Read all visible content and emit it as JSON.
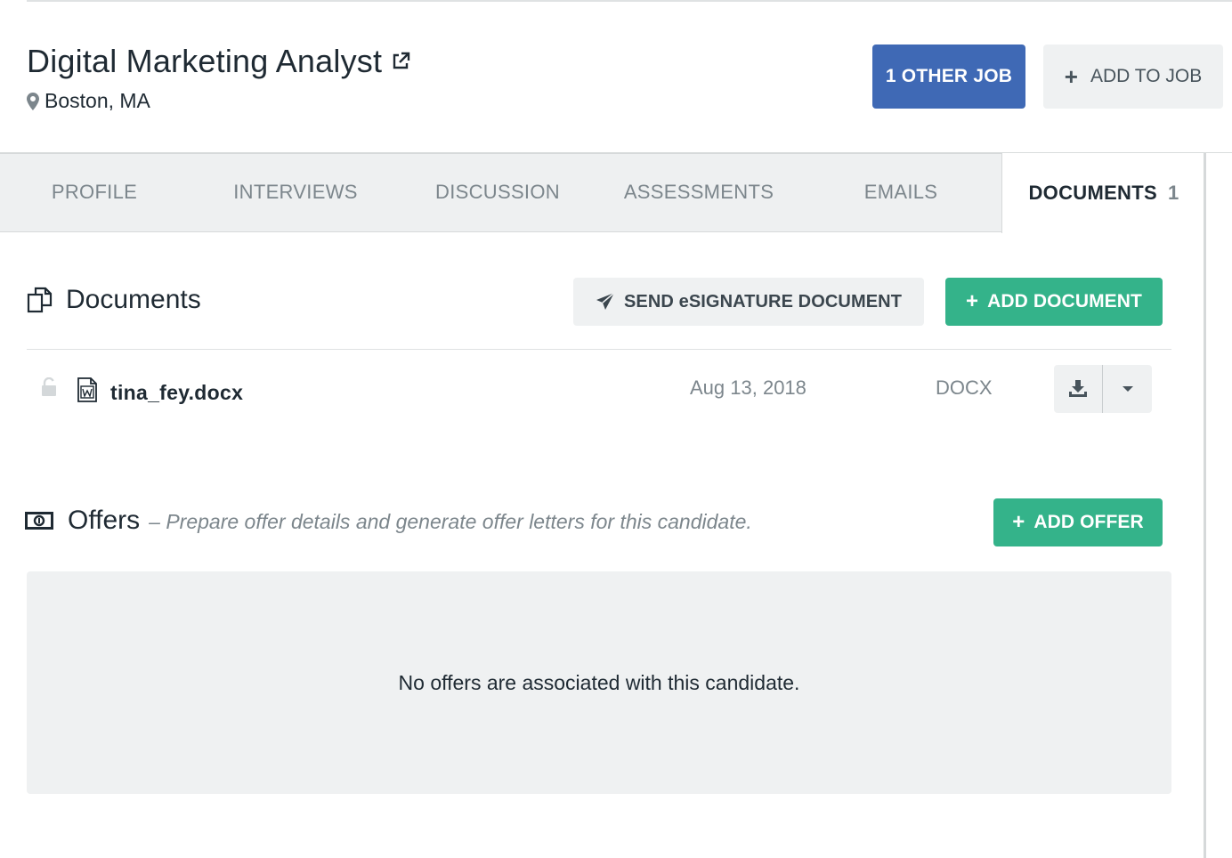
{
  "job": {
    "title": "Digital Marketing Analyst",
    "location": "Boston, MA",
    "other_job_label": "1 OTHER JOB",
    "add_to_job_label": "ADD TO JOB"
  },
  "tabs": [
    {
      "label": "PROFILE"
    },
    {
      "label": "INTERVIEWS"
    },
    {
      "label": "DISCUSSION"
    },
    {
      "label": "ASSESSMENTS"
    },
    {
      "label": "EMAILS"
    },
    {
      "label": "DOCUMENTS",
      "count": "1",
      "active": true
    }
  ],
  "documents": {
    "title": "Documents",
    "send_esign_label": "SEND eSIGNATURE DOCUMENT",
    "add_document_label": "ADD DOCUMENT",
    "items": [
      {
        "name": "tina_fey.docx",
        "date": "Aug 13, 2018",
        "type": "DOCX"
      }
    ]
  },
  "offers": {
    "title": "Offers",
    "subtitle": "– Prepare offer details and generate offer letters for this candidate.",
    "add_offer_label": "ADD OFFER",
    "empty_message": "No offers are associated with this candidate."
  },
  "colors": {
    "primary_blue": "#3f69b5",
    "accent_green": "#34b38a",
    "muted_gray": "#7c868c",
    "panel_gray": "#eff1f2"
  },
  "icons": [
    "external-link-icon",
    "map-pin-icon",
    "plus-icon",
    "documents-icon",
    "paper-plane-icon",
    "lock-icon",
    "word-file-icon",
    "download-icon",
    "caret-down-icon",
    "money-icon"
  ]
}
